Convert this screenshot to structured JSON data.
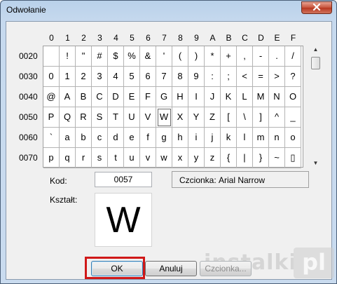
{
  "window": {
    "title": "Odwołanie"
  },
  "grid": {
    "columns": [
      "0",
      "1",
      "2",
      "3",
      "4",
      "5",
      "6",
      "7",
      "8",
      "9",
      "A",
      "B",
      "C",
      "D",
      "E",
      "F"
    ],
    "rows": [
      {
        "code": "0020",
        "chars": [
          "",
          "!",
          "\"",
          "#",
          "$",
          "%",
          "&",
          "'",
          "(",
          ")",
          "*",
          "+",
          ",",
          "-",
          ".",
          "/"
        ]
      },
      {
        "code": "0030",
        "chars": [
          "0",
          "1",
          "2",
          "3",
          "4",
          "5",
          "6",
          "7",
          "8",
          "9",
          ":",
          ";",
          "<",
          "=",
          ">",
          "?"
        ]
      },
      {
        "code": "0040",
        "chars": [
          "@",
          "A",
          "B",
          "C",
          "D",
          "E",
          "F",
          "G",
          "H",
          "I",
          "J",
          "K",
          "L",
          "M",
          "N",
          "O"
        ]
      },
      {
        "code": "0050",
        "chars": [
          "P",
          "Q",
          "R",
          "S",
          "T",
          "U",
          "V",
          "W",
          "X",
          "Y",
          "Z",
          "[",
          "\\",
          "]",
          "^",
          "_"
        ]
      },
      {
        "code": "0060",
        "chars": [
          "`",
          "a",
          "b",
          "c",
          "d",
          "e",
          "f",
          "g",
          "h",
          "i",
          "j",
          "k",
          "l",
          "m",
          "n",
          "o"
        ]
      },
      {
        "code": "0070",
        "chars": [
          "p",
          "q",
          "r",
          "s",
          "t",
          "u",
          "v",
          "w",
          "x",
          "y",
          "z",
          "{",
          "|",
          "}",
          "~",
          "▯"
        ]
      }
    ],
    "selected": {
      "row": 3,
      "col": 7
    }
  },
  "code": {
    "label": "Kod:",
    "value": "0057"
  },
  "font": {
    "label": "Czcionka:",
    "value": "Arial Narrow"
  },
  "shape": {
    "label": "Kształt:",
    "preview": "W"
  },
  "buttons": {
    "ok": "OK",
    "cancel": "Anuluj",
    "font": "Czcionka..."
  },
  "watermark": {
    "text": "instalki",
    "badge": "pl"
  }
}
